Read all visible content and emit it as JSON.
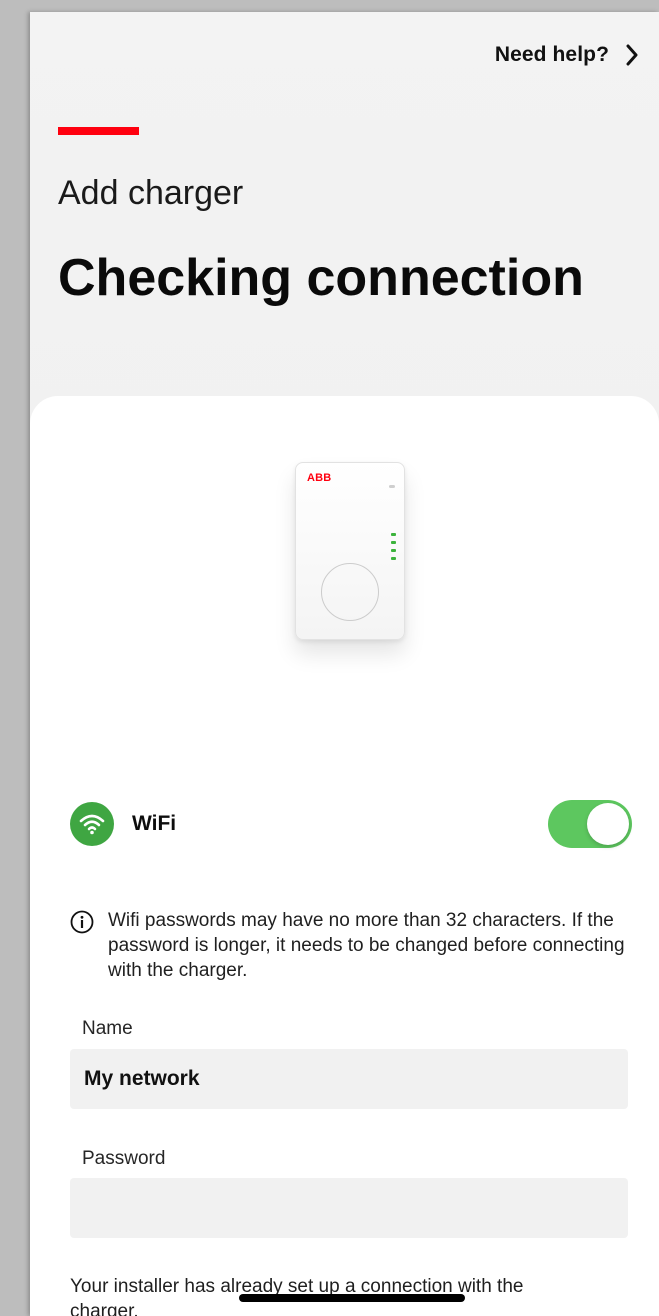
{
  "header": {
    "help_label": "Need help?",
    "help_icon": "chevron-right-icon"
  },
  "page": {
    "accent_color": "#ff000f",
    "subtitle": "Add charger",
    "title": "Checking connection"
  },
  "charger_image": {
    "brand": "ABB",
    "led_color": "#3cb33c"
  },
  "wifi": {
    "icon": "wifi-icon",
    "label": "WiFi",
    "enabled": true,
    "toggle_color": "#5dc75f"
  },
  "info": {
    "icon": "info-icon",
    "text": "Wifi passwords may have no more than 32 characters. If the password is longer, it needs to be changed before connecting with the charger."
  },
  "form": {
    "name_label": "Name",
    "name_value": "My network",
    "password_label": "Password",
    "password_value": ""
  },
  "footer": {
    "installer_note": "Your installer has already set up a connection with the charger."
  }
}
